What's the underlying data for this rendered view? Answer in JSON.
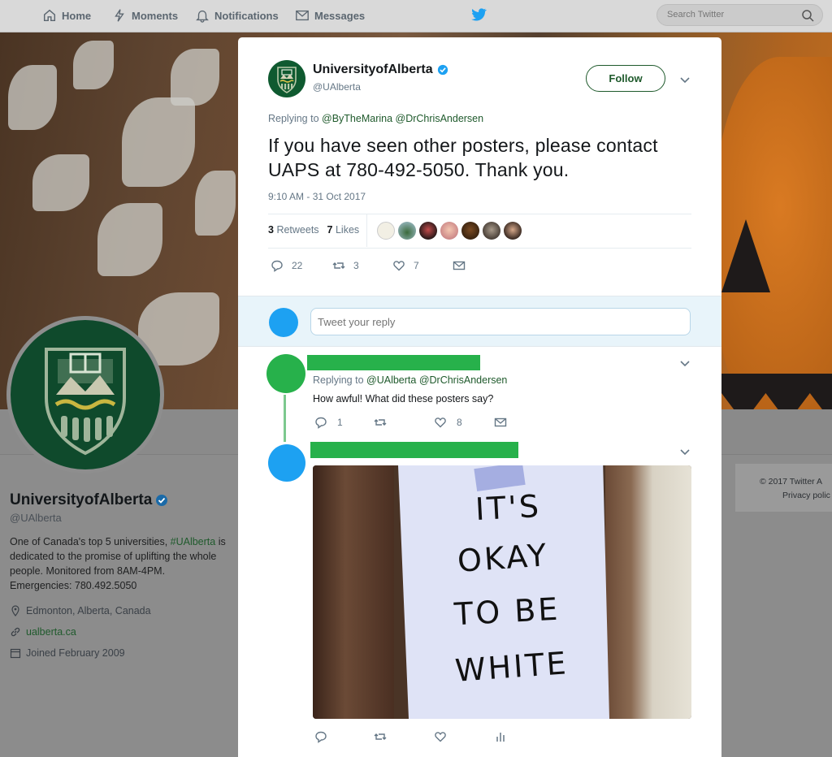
{
  "nav": {
    "home": "Home",
    "moments": "Moments",
    "notifications": "Notifications",
    "messages": "Messages",
    "search_placeholder": "Search Twitter"
  },
  "profile": {
    "name": "UniversityofAlberta",
    "handle": "@UAlberta",
    "bio_1": "One of Canada's top 5 universities, ",
    "bio_tag": "#UAlberta",
    "bio_2": " is dedicated to the promise of uplifting the whole people. Monitored from 8AM-4PM. Emergencies: 780.492.5050",
    "location": "Edmonton, Alberta, Canada",
    "website": "ualberta.ca",
    "joined": "Joined February 2009"
  },
  "right_card": {
    "line1": "© 2017 Twitter   A",
    "line2": "Privacy polic"
  },
  "tweet": {
    "author_name": "UniversityofAlberta",
    "author_handle": "@UAlberta",
    "follow_label": "Follow",
    "replying_prefix": "Replying to ",
    "replying_to_1": "@ByTheMarina",
    "replying_to_2": "@DrChrisAndersen",
    "text": "If you have seen other posters, please contact UAPS at 780-492-5050. Thank you.",
    "timestamp": "9:10 AM - 31 Oct 2017",
    "retweets_count": "3",
    "retweets_label": "Retweets",
    "likes_count": "7",
    "likes_label": "Likes",
    "actions": {
      "replies": "22",
      "retweets": "3",
      "likes": "7"
    }
  },
  "reply_box": {
    "placeholder": "Tweet your reply"
  },
  "replies": [
    {
      "replying_prefix": "Replying to ",
      "replying_to_1": "@UAlberta",
      "replying_to_2": "@DrChrisAndersen",
      "text": "How awful! What did these posters say?",
      "actions": {
        "replies": "1",
        "retweets": "",
        "likes": "8"
      }
    },
    {
      "image_sign": [
        "IT'S",
        "OKAY",
        "TO BE",
        "WHITE"
      ]
    }
  ],
  "colors": {
    "brand_green": "#1f5a2c",
    "redaction_green": "#27b14b",
    "twitter_blue": "#1da1f2"
  }
}
